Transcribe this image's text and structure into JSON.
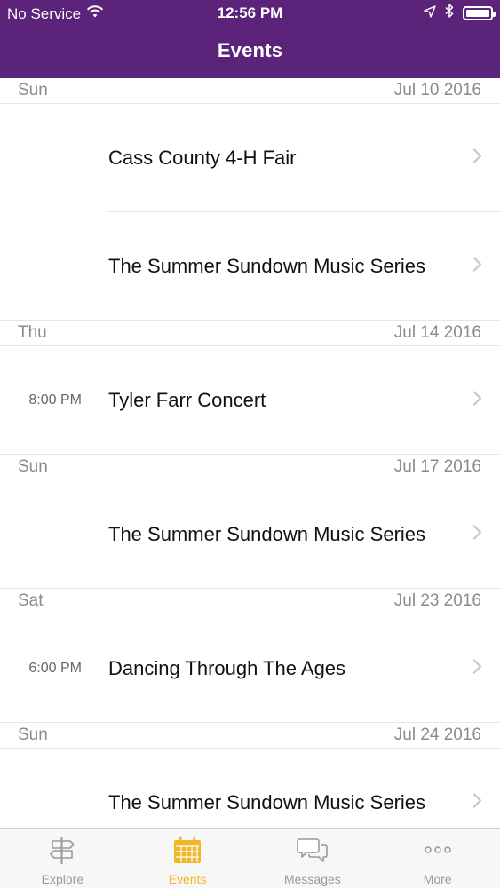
{
  "status_bar": {
    "carrier": "No Service",
    "time": "12:56 PM"
  },
  "nav": {
    "title": "Events"
  },
  "sections": [
    {
      "day": "Sun",
      "date": "Jul 10 2016",
      "events": [
        {
          "time": "",
          "title": "Cass County 4-H Fair"
        },
        {
          "time": "",
          "title": "The Summer Sundown Music Series"
        }
      ]
    },
    {
      "day": "Thu",
      "date": "Jul 14 2016",
      "events": [
        {
          "time": "8:00 PM",
          "title": "Tyler Farr Concert"
        }
      ]
    },
    {
      "day": "Sun",
      "date": "Jul 17 2016",
      "events": [
        {
          "time": "",
          "title": "The Summer Sundown Music Series"
        }
      ]
    },
    {
      "day": "Sat",
      "date": "Jul 23 2016",
      "events": [
        {
          "time": "6:00 PM",
          "title": "Dancing Through The Ages"
        }
      ]
    },
    {
      "day": "Sun",
      "date": "Jul 24 2016",
      "events": [
        {
          "time": "",
          "title": "The Summer Sundown Music Series"
        }
      ]
    }
  ],
  "tab_bar": {
    "tabs": [
      {
        "label": "Explore",
        "icon": "signpost-icon"
      },
      {
        "label": "Events",
        "icon": "calendar-icon"
      },
      {
        "label": "Messages",
        "icon": "chat-bubbles-icon"
      },
      {
        "label": "More",
        "icon": "more-dots-icon"
      }
    ],
    "active_color": "#f0b72a",
    "inactive_color": "#9a9a9e"
  },
  "colors": {
    "nav_background": "#5b2379"
  }
}
